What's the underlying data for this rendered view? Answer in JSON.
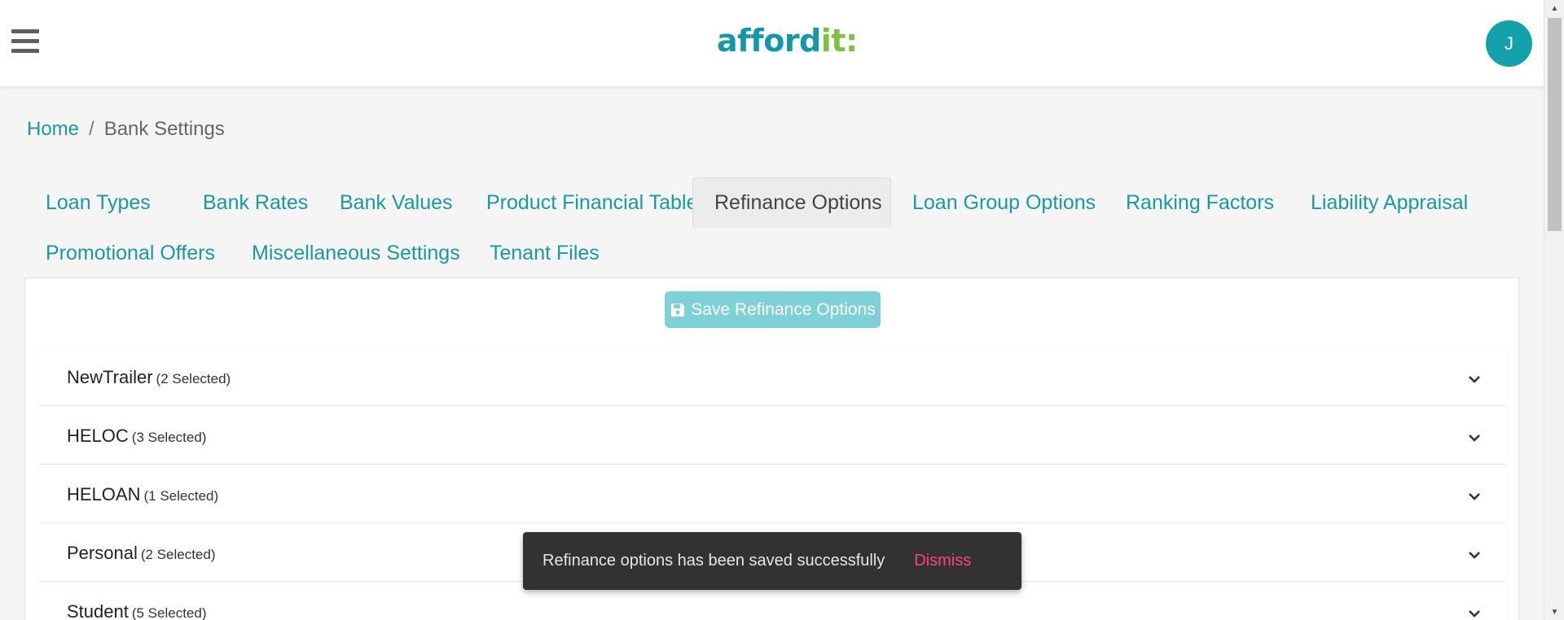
{
  "header": {
    "logo_main": "afford",
    "logo_accent": "it:",
    "avatar_initial": "J"
  },
  "breadcrumb": {
    "home": "Home",
    "separator": "/",
    "current": "Bank Settings"
  },
  "tabs": [
    {
      "label": "Loan Types"
    },
    {
      "label": "Bank Rates"
    },
    {
      "label": "Bank Values"
    },
    {
      "label": "Product Financial Tables"
    },
    {
      "label": "Refinance Options",
      "active": true
    },
    {
      "label": "Loan Group Options"
    },
    {
      "label": "Ranking Factors"
    },
    {
      "label": "Liability Appraisal"
    },
    {
      "label": "Promotional Offers"
    },
    {
      "label": "Miscellaneous Settings"
    },
    {
      "label": "Tenant Files"
    }
  ],
  "save_button": {
    "label": "Save Refinance Options",
    "icon": "save-icon"
  },
  "loan_types": [
    {
      "name": "NewTrailer",
      "count": "(2 Selected)"
    },
    {
      "name": "HELOC",
      "count": "(3 Selected)"
    },
    {
      "name": "HELOAN",
      "count": "(1 Selected)"
    },
    {
      "name": "Personal",
      "count": "(2 Selected)"
    },
    {
      "name": "Student",
      "count": "(5 Selected)"
    }
  ],
  "toast": {
    "message": "Refinance options has been saved successfully",
    "action": "Dismiss"
  },
  "colors": {
    "brand_teal": "#1a98a6",
    "brand_green": "#7ec242",
    "save_button_bg": "#7fd1d8",
    "toast_bg": "#323232",
    "toast_action": "#ff4081"
  }
}
